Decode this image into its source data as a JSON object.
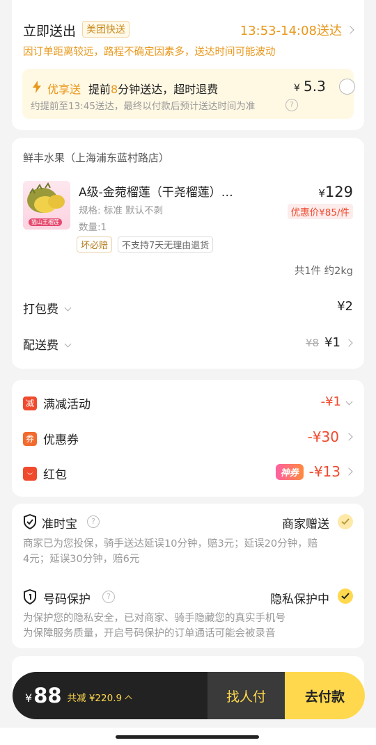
{
  "delivery": {
    "title": "立即送出",
    "service_tag": "美团快送",
    "time_window": "13:53-14:08送达",
    "warning": "因订单距离较远，路程不确定因素多，送达时间可能波动",
    "priority": {
      "name": "优享送",
      "desc_pre": "提前",
      "minutes": "8",
      "desc_post": "分钟送达，超时退费",
      "currency": "¥",
      "price": "5.3",
      "note": "约提前至13:45送达，最终以付款后预计送达时间为准"
    }
  },
  "store": {
    "name": "鲜丰水果（上海浦东蓝村路店）",
    "item": {
      "title": "A级-金菀榴莲（干尧榴莲）…",
      "spec": "规格: 标准  默认不剥",
      "qty": "数量:1",
      "badge1": "坏必赔",
      "badge2": "不支持7天无理由退货",
      "currency": "¥",
      "price": "129",
      "discount": "优惠价¥85/件",
      "image_caption": "猫山王榴莲"
    },
    "summary": "共1件 约2kg",
    "packing": {
      "label": "打包费",
      "amount": "¥2"
    },
    "shipping": {
      "label": "配送费",
      "original": "¥8",
      "amount": "¥1"
    }
  },
  "discounts": {
    "full_reduction": {
      "icon_text": "减",
      "label": "满减活动",
      "amount": "-¥1"
    },
    "coupon": {
      "icon_text": "券",
      "label": "优惠券",
      "amount": "-¥30"
    },
    "red_packet": {
      "label": "红包",
      "badge": "神券",
      "amount": "-¥13"
    }
  },
  "services": {
    "ontime": {
      "title": "准时宝",
      "status": "商家赠送",
      "desc1": "商家已为您投保，骑手送达延误10分钟，赔3元；延误20分钟，赔",
      "desc2": "4元；延误30分钟，赔6元"
    },
    "privacy": {
      "title": "号码保护",
      "status": "隐私保护中",
      "desc1": "为保护您的隐私安全，已对商家、骑手隐藏您的真实手机号",
      "desc2": "为保障服务质量，开启号码保护的订单通话可能会被录音"
    }
  },
  "checkout": {
    "currency": "¥",
    "total": "88",
    "saved": "共减 ¥220.9",
    "friend_pay": "找人付",
    "pay": "去付款"
  },
  "colors": {
    "accent_yellow": "#ffd84d",
    "orange": "#e8971a",
    "red": "#f04a2e",
    "dark": "#222222"
  }
}
